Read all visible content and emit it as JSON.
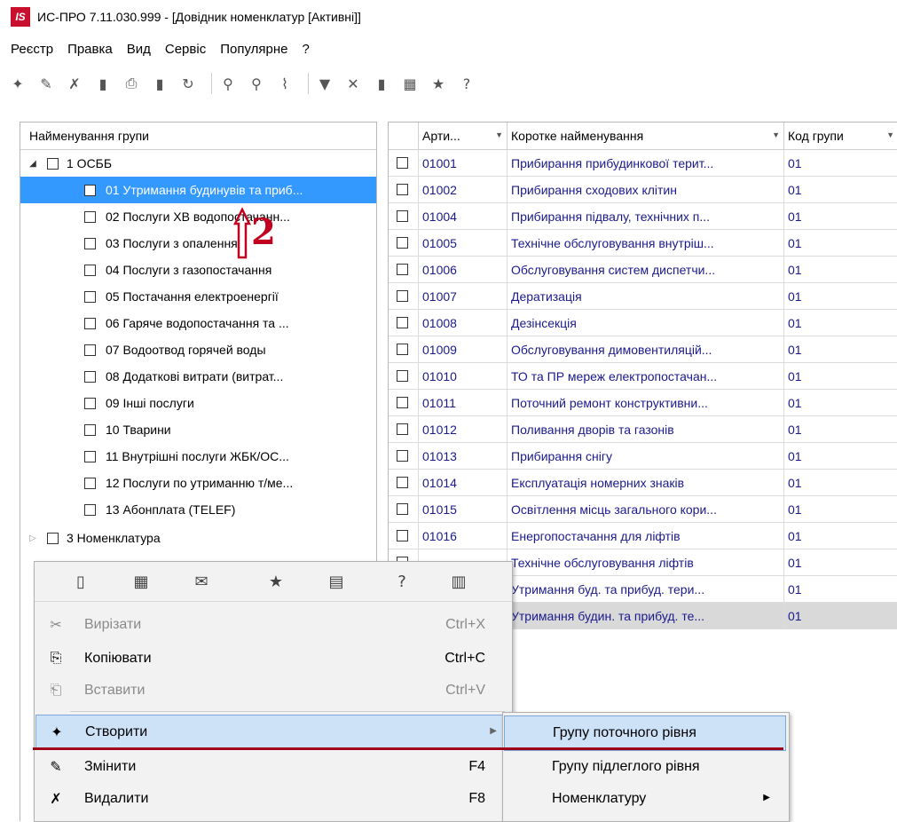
{
  "window": {
    "title": "ИС-ПРО 7.11.030.999 - [Довідник номенклатур [Активні]]",
    "logo_text": "IS"
  },
  "menubar": [
    "Реєстр",
    "Правка",
    "Вид",
    "Сервіс",
    "Популярне",
    "?"
  ],
  "left_panel": {
    "header": "Найменування групи",
    "rows": [
      {
        "label": "1 ОСББ",
        "level": 0,
        "expander": "◢"
      },
      {
        "label": "01 Утримання будинувів та приб...",
        "level": 1,
        "selected": true
      },
      {
        "label": "02 Послуги ХВ водопостачанн...",
        "level": 1
      },
      {
        "label": "03 Послуги з опалення",
        "level": 1
      },
      {
        "label": "04 Послуги з газопостачання",
        "level": 1
      },
      {
        "label": "05 Постачання електроенергії",
        "level": 1
      },
      {
        "label": "06 Гаряче водопостачання та ...",
        "level": 1
      },
      {
        "label": "07 Водоотвод горячей воды",
        "level": 1
      },
      {
        "label": "08 Додаткові витрати (витрат...",
        "level": 1
      },
      {
        "label": "09 Інші послуги",
        "level": 1
      },
      {
        "label": "10 Тварини",
        "level": 1
      },
      {
        "label": "11  Внутрішні  послуги ЖБК/ОС...",
        "level": 1
      },
      {
        "label": "12 Послуги по утриманню т/ме...",
        "level": 1
      },
      {
        "label": "13 Абонплата  (TELEF)",
        "level": 1
      },
      {
        "label": "3 Номенклатура",
        "level": 0,
        "expander": "▷"
      }
    ]
  },
  "grid": {
    "columns": [
      "Арти...",
      "Коротке найменування",
      "Код групи"
    ],
    "rows": [
      {
        "code": "01001",
        "name": "Прибирання прибудинкової терит...",
        "group": "01"
      },
      {
        "code": "01002",
        "name": "Прибирання сходових клітин",
        "group": "01"
      },
      {
        "code": "01004",
        "name": "Прибирання підвалу, технічних п...",
        "group": "01"
      },
      {
        "code": "01005",
        "name": "Технічне обслуговування внутріш...",
        "group": "01"
      },
      {
        "code": "01006",
        "name": "Обслуговування систем диспетчи...",
        "group": "01"
      },
      {
        "code": "01007",
        "name": "Дератизація",
        "group": "01"
      },
      {
        "code": "01008",
        "name": "Дезінсекція",
        "group": "01"
      },
      {
        "code": "01009",
        "name": "Обслуговування димовентиляцій...",
        "group": "01"
      },
      {
        "code": "01010",
        "name": "ТО та ПР мереж електропостачан...",
        "group": "01"
      },
      {
        "code": "01011",
        "name": "Поточний ремонт конструктивни...",
        "group": "01"
      },
      {
        "code": "01012",
        "name": "Поливання дворів та газонів",
        "group": "01"
      },
      {
        "code": "01013",
        "name": "Прибирання снігу",
        "group": "01"
      },
      {
        "code": "01014",
        "name": "Експлуатація номерних знаків",
        "group": "01"
      },
      {
        "code": "01015",
        "name": "Освітлення місць загального кори...",
        "group": "01"
      },
      {
        "code": "01016",
        "name": "Енергопостачання для ліфтів",
        "group": "01"
      },
      {
        "code": "",
        "name": "Технічне обслуговування ліфтів",
        "group": "01"
      },
      {
        "code": "",
        "name": "Утримання буд. та прибуд. тери...",
        "group": "01"
      },
      {
        "code": "",
        "name": "Утримання будин. та прибуд. те...",
        "group": "01",
        "highlight": true
      }
    ]
  },
  "annotation": {
    "text": "2"
  },
  "context_menu": {
    "items": [
      {
        "label": "Вирізати",
        "shortcut": "Ctrl+X",
        "disabled": true,
        "icon": "scissors-icon"
      },
      {
        "label": "Копіювати",
        "shortcut": "Ctrl+C",
        "disabled": false,
        "icon": "copy-icon"
      },
      {
        "label": "Вставити",
        "shortcut": "Ctrl+V",
        "disabled": true,
        "icon": "paste-icon"
      },
      {
        "label": "Створити",
        "shortcut": "",
        "active": true,
        "icon": "create-icon"
      },
      {
        "label": "Змінити",
        "shortcut": "F4",
        "icon": "edit-icon"
      },
      {
        "label": "Видалити",
        "shortcut": "F8",
        "icon": "delete-icon"
      }
    ]
  },
  "submenu": {
    "items": [
      {
        "label": "Групу поточного рівня",
        "active": true
      },
      {
        "label": "Групу підлеглого рівня"
      },
      {
        "label": "Номенклатуру",
        "has_submenu": true
      }
    ]
  },
  "colors": {
    "selected": "#3399ff",
    "accent_red": "#a00018",
    "grid_text": "#1a1a8c"
  }
}
